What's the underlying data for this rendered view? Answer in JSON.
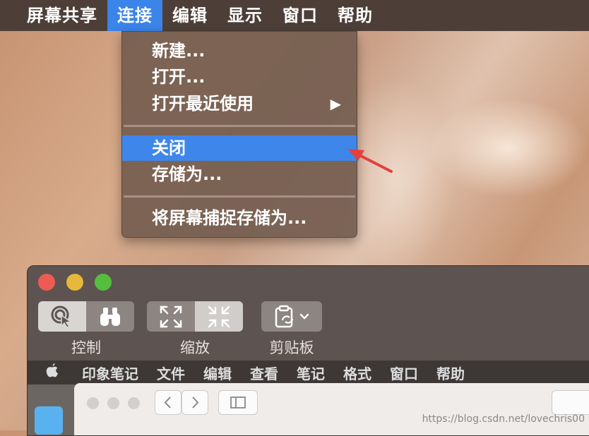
{
  "menubar": {
    "items": [
      "屏幕共享",
      "连接",
      "编辑",
      "显示",
      "窗口",
      "帮助"
    ],
    "active_index": 1
  },
  "dropdown": {
    "items": {
      "new": "新建...",
      "open": "打开...",
      "open_recent": "打开最近使用",
      "close": "关闭",
      "save_as": "存储为...",
      "save_screenshot": "将屏幕捕捉存储为..."
    },
    "highlighted": "关闭"
  },
  "toolbar": {
    "control_label": "控制",
    "zoom_label": "缩放",
    "clipboard_label": "剪贴板"
  },
  "remote_menubar": {
    "items": [
      "印象笔记",
      "文件",
      "编辑",
      "查看",
      "笔记",
      "格式",
      "窗口",
      "帮助"
    ]
  },
  "watermark": "https://blog.csdn.net/lovechris00",
  "colors": {
    "menu_highlight": "#3e86ea",
    "arrow": "#e2403f",
    "traffic_red": "#ee5b55",
    "traffic_yellow": "#e6b93a",
    "traffic_green": "#55be3f"
  },
  "icons": {
    "submenu_arrow": "triangle-right-icon",
    "control_tool": "cursor-click-icon",
    "observe_tool": "binoculars-icon",
    "fullscreen": "expand-icon",
    "scale": "shrink-icon",
    "clipboard": "clipboard-sync-icon",
    "apple": "apple-icon"
  }
}
